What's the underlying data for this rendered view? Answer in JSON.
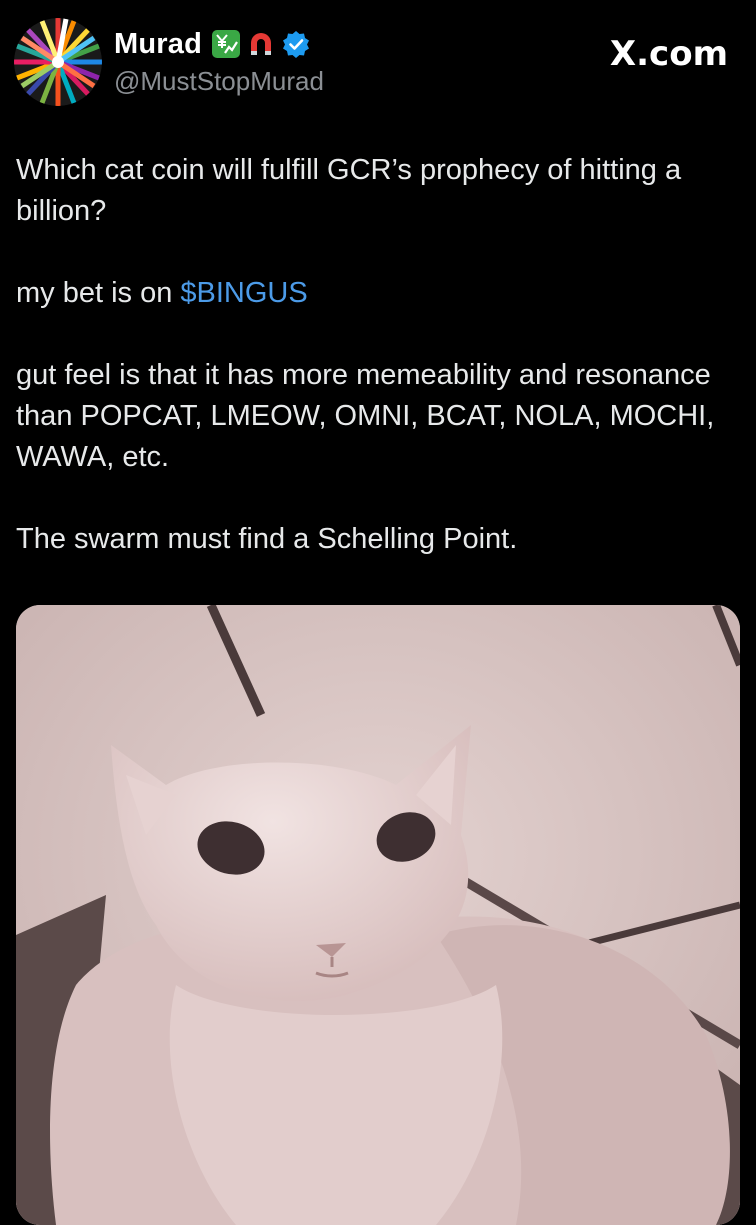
{
  "header": {
    "display_name": "Murad",
    "handle": "@MustStopMurad",
    "platform": "X.com",
    "badges": [
      "yen-chart-icon",
      "magnet-icon",
      "verified-badge-icon"
    ],
    "verified_color": "#1d9bf0"
  },
  "tweet": {
    "line1": "Which cat coin will fulfill GCR’s prophecy of hitting a billion?",
    "line2_prefix": "my bet is on ",
    "line2_cashtag": "$BINGUS",
    "line3": "gut feel is that it has more memeability and resonance than POPCAT, LMEOW, OMNI, BCAT, NOLA, MOCHI, WAWA, etc.",
    "line4": "The swarm must find a Schelling Point."
  },
  "colors": {
    "background": "#000000",
    "text": "#e7e9ea",
    "secondary_text": "#8b8f94",
    "link": "#4c9be8"
  }
}
